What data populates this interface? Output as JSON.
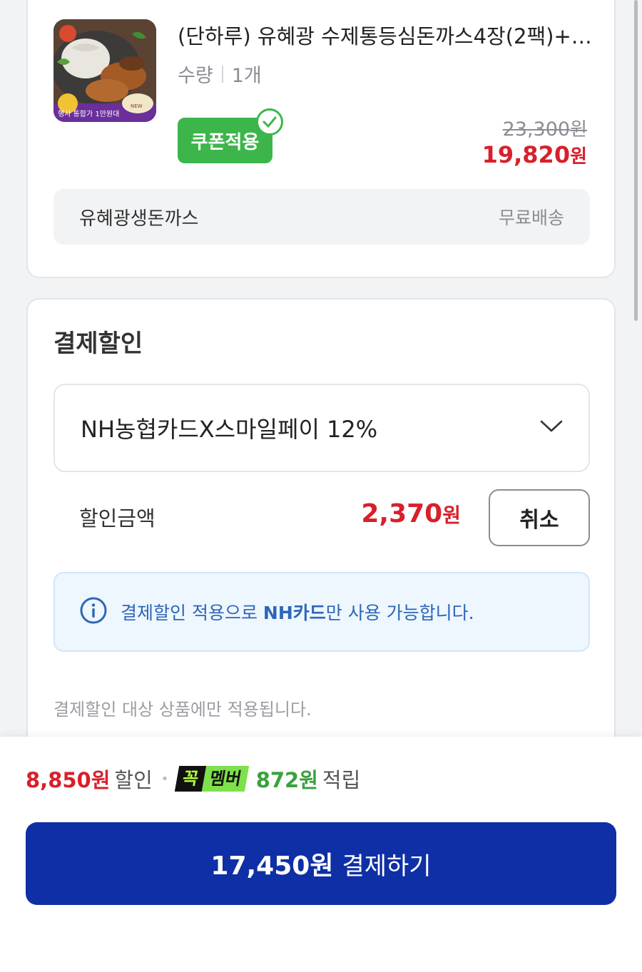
{
  "product": {
    "title": "(단하루) 유혜광 수제통등심돈까스4장(2팩)+…",
    "quantity_label": "수량",
    "quantity_value": "1개",
    "coupon_badge": "쿠폰적용",
    "original_price": "23,300",
    "sale_price": "19,820",
    "currency": "원",
    "shop_name": "유혜광생돈까스",
    "shipping": "무료배송",
    "thumbnail_texts": [
      "행사 통합가 1만원대",
      "NEW"
    ]
  },
  "discount": {
    "title": "결제할인",
    "selected_option": "NH농협카드X스마일페이 12%",
    "amount_label": "할인금액",
    "amount": "2,370",
    "currency": "원",
    "cancel_label": "취소",
    "info_prefix": "결제할인 적용으로 ",
    "info_bold": "NH카드",
    "info_suffix": "만 사용 가능합니다.",
    "note": "결제할인 대상 상품에만 적용됩니다."
  },
  "summary": {
    "discount_amount": "8,850원",
    "discount_label": "할인",
    "member_logo_a": "꼭",
    "member_logo_b": "멤버",
    "points": "872원",
    "points_label": "적립"
  },
  "pay_button": {
    "amount": "17,450원",
    "label": "결제하기"
  },
  "colors": {
    "accent_red": "#d8202b",
    "coupon_green": "#3cb64a",
    "pay_blue": "#0f2fa6",
    "info_blue": "#2d66b8"
  }
}
